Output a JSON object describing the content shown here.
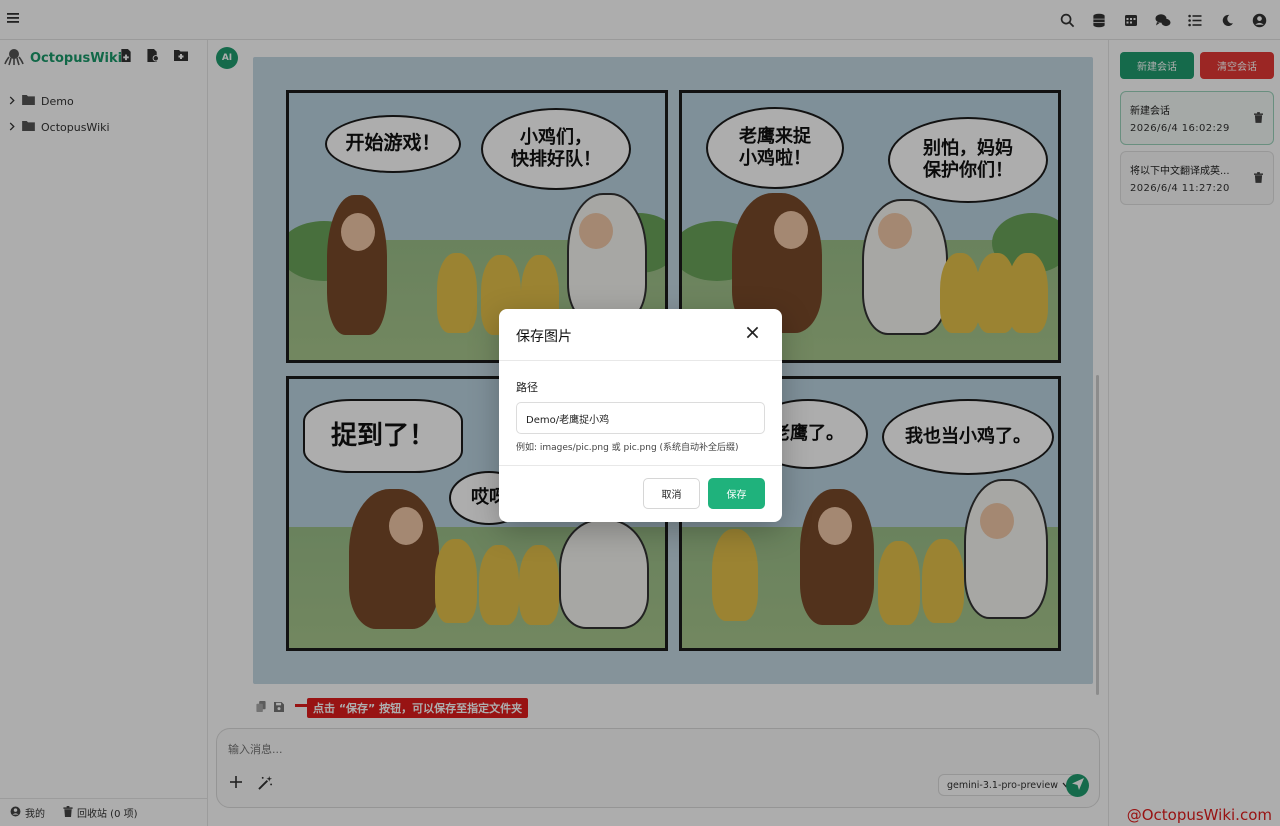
{
  "app": {
    "brand_name": "OctopusWiki"
  },
  "topbar": {
    "icons": [
      "menu-icon",
      "search-icon",
      "database-icon",
      "calendar-icon",
      "chat-icon",
      "list-icon",
      "moon-icon",
      "user-icon"
    ]
  },
  "sidebar": {
    "tree": [
      {
        "label": "Demo"
      },
      {
        "label": "OctopusWiki"
      }
    ],
    "footer": {
      "mine_label": "我的",
      "trash_label": "回收站 (0 项)"
    }
  },
  "chat": {
    "avatar_label": "AI",
    "comic": {
      "bubbles": {
        "p1_a": "开始游戏！",
        "p1_b": "小鸡们，\n快排好队！",
        "p2_a": "老鹰来捉\n小鸡啦！",
        "p2_b": "别怕，妈妈\n保护你们！",
        "p3_a": "捉到了！",
        "p3_b": "哎呀",
        "p4_a": "老鹰了。",
        "p4_b": "我也当小鸡了。"
      }
    },
    "annotation": "点击 “保存” 按钮，可以保存至指定文件夹"
  },
  "composer": {
    "placeholder": "输入消息...",
    "model": "gemini-3.1-pro-preview"
  },
  "right_panel": {
    "new_button": "新建会话",
    "clear_button": "清空会话",
    "sessions": [
      {
        "title": "新建会话",
        "time": "2026/6/4 16:02:29"
      },
      {
        "title": "将以下中文翻译成英...",
        "time": "2026/6/4 11:27:20"
      }
    ]
  },
  "modal": {
    "title": "保存图片",
    "field_label": "路径",
    "path_value": "Demo/老鹰捉小鸡",
    "hint": "例如: images/pic.png 或 pic.png (系统自动补全后缀)",
    "cancel_label": "取消",
    "save_label": "保存"
  },
  "watermark": "@OctopusWiki.com",
  "colors": {
    "brand": "#1a9a6a",
    "accent": "#1fb27c",
    "danger": "#e53935",
    "annotation": "#e11d1d"
  }
}
